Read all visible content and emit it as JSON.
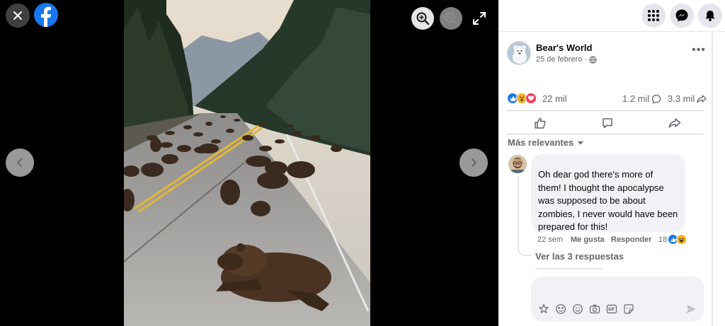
{
  "viewer": {
    "close_icon": "close-icon",
    "logo_icon": "facebook-logo-icon",
    "zoom_in_icon": "zoom-in-icon",
    "zoom_out_icon": "zoom-out-icon",
    "fullscreen_icon": "fullscreen-icon",
    "prev_icon": "chevron-left-icon",
    "next_icon": "chevron-right-icon",
    "photo_description_icon": "bears-on-highway-photo"
  },
  "topbar": {
    "icons": [
      "menu-grid-icon",
      "messenger-icon",
      "notifications-bell-icon"
    ]
  },
  "post": {
    "author": "Bear's World",
    "date": "25 de febrero",
    "privacy_icon": "globe-icon",
    "more_icon": "more-options-icon",
    "reaction_count": "22 mil",
    "comment_count": "1.2 mil",
    "share_count": "3.3 mil",
    "reaction_types": [
      "like",
      "wow",
      "love"
    ]
  },
  "actions": {
    "icons": [
      "like-icon",
      "comment-icon",
      "share-icon"
    ]
  },
  "comments": {
    "sort_label": "Más relevantes",
    "items": [
      {
        "text": "Oh dear god there's more of them! I thought the apocalypse was supposed to be about zombies, I never would have been prepared for this!",
        "time": "22 sem",
        "like_label": "Me gusta",
        "reply_label": "Responder",
        "reaction_count": "18",
        "view_replies": "Ver las 3 respuestas"
      }
    ]
  },
  "composer": {
    "placeholder": "",
    "icons": [
      "avatar-sticker-icon",
      "emoji-icon",
      "smiley-icon",
      "camera-icon",
      "gif-icon",
      "sticker-icon",
      "send-icon"
    ]
  },
  "colors": {
    "like_blue": "#1877f2",
    "love_red": "#f33e58",
    "wow_yellow": "#f7b125",
    "panel_bg": "#ffffff",
    "bubble_bg": "#f0f2f5"
  }
}
